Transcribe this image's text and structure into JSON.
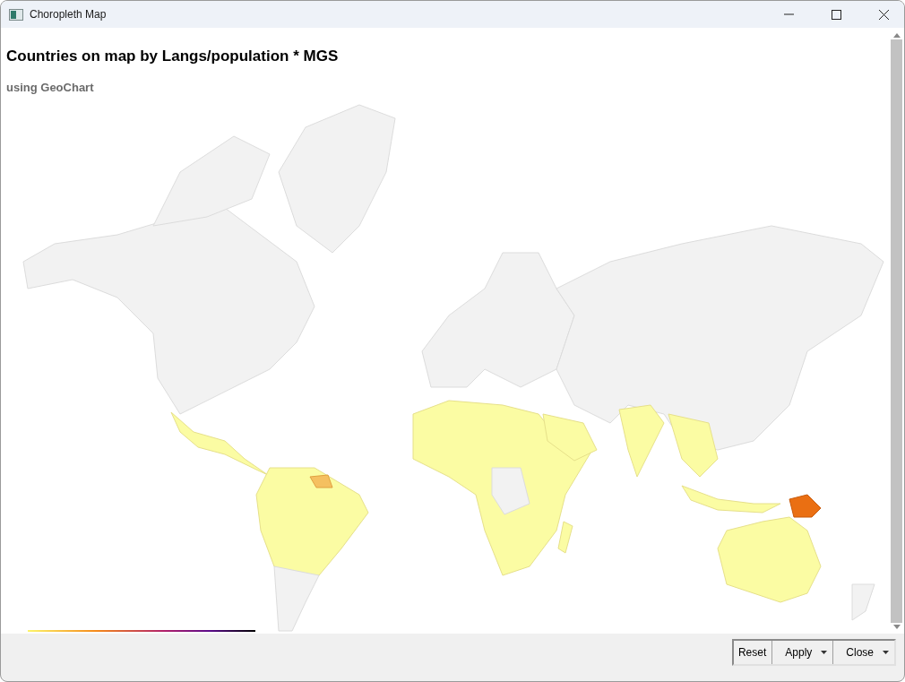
{
  "window": {
    "title": "Choropleth Map"
  },
  "chart": {
    "title": "Countries on map by Langs/population * MGS",
    "subtitle": "using GeoChart"
  },
  "buttons": [
    {
      "label": "Reset",
      "kind": "plain"
    },
    {
      "label": "Apply",
      "kind": "split"
    },
    {
      "label": "Close",
      "kind": "split"
    }
  ]
}
